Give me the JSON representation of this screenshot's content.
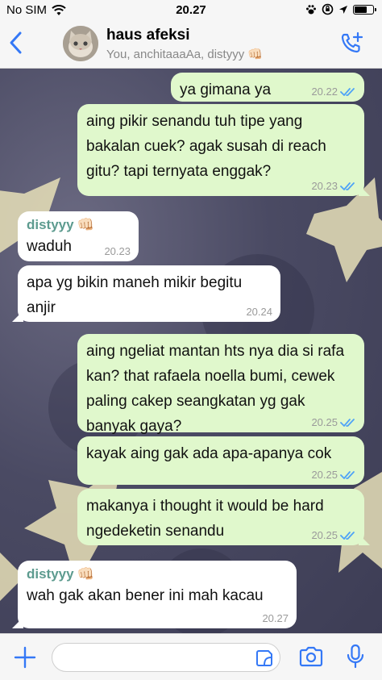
{
  "status_bar": {
    "carrier": "No SIM",
    "time": "20.27",
    "battery_level": 0.7
  },
  "header": {
    "title": "haus afeksi",
    "subtitle": "You, anchitaaaAa, distyyy 👊🏻",
    "back_icon": "chevron-left-icon",
    "call_icon": "phone-plus-icon"
  },
  "messages": [
    {
      "direction": "out",
      "text": "ya gimana ya",
      "time": "20.22",
      "read": true
    },
    {
      "direction": "out",
      "text": "aing pikir senandu tuh tipe yang bakalan cuek? agak susah di reach gitu? tapi ternyata enggak?",
      "time": "20.23",
      "read": true
    },
    {
      "direction": "in",
      "sender": "distyyy",
      "sender_emoji": "👊🏻",
      "text": "waduh",
      "time": "20.23"
    },
    {
      "direction": "in",
      "text": "apa yg bikin maneh mikir begitu anjir",
      "time": "20.24"
    },
    {
      "direction": "out",
      "text": "aing ngeliat mantan hts nya dia si rafa kan? that rafaela noella bumi, cewek paling cakep seangkatan yg gak banyak gaya?",
      "time": "20.25",
      "read": true
    },
    {
      "direction": "out",
      "text": "kayak aing gak ada apa-apanya cok",
      "time": "20.25",
      "read": true
    },
    {
      "direction": "out",
      "text": "makanya i thought it would be hard ngedeketin senandu",
      "time": "20.25",
      "read": true
    },
    {
      "direction": "in",
      "sender": "distyyy",
      "sender_emoji": "👊🏻",
      "text": "wah gak akan bener ini mah kacau",
      "time": "20.27"
    }
  ],
  "colors": {
    "outgoing_bubble": "#e0f8cc",
    "incoming_bubble": "#ffffff",
    "accent": "#3478f6",
    "sender_name": "#5d9b8f",
    "read_ticks": "#4fa3f7"
  },
  "input_bar": {
    "icons": [
      "plus-icon",
      "sticker-icon",
      "camera-icon",
      "microphone-icon"
    ]
  }
}
